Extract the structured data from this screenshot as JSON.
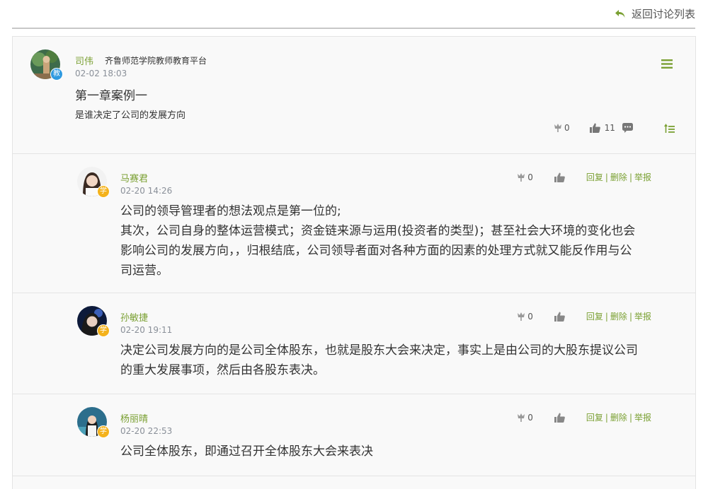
{
  "header": {
    "back_label": "返回讨论列表"
  },
  "topic": {
    "author": "司伟",
    "org": "齐鲁师范学院教师教育平台",
    "date": "02-02 18:03",
    "badge": "教",
    "title": "第一章案例一",
    "description": "是谁决定了公司的发展方向",
    "flower_count": "0",
    "like_count": "11"
  },
  "replies": [
    {
      "author": "马赛君",
      "date": "02-20 14:26",
      "badge": "学",
      "flower_count": "0",
      "reply_label": "回复",
      "delete_label": "删除",
      "report_label": "举报",
      "sep": "|",
      "lines": [
        "公司的领导管理者的想法观点是第一位的;",
        "其次，公司自身的整体运营模式；资金链来源与运用(投资者的类型)；甚至社会大环境的变化也会",
        "影响公司的发展方向，，归根结底，公司领导者面对各种方面的因素的处理方式就又能反作用与公",
        "司运营。"
      ]
    },
    {
      "author": "孙敏捷",
      "date": "02-20 19:11",
      "badge": "学",
      "flower_count": "0",
      "reply_label": "回复",
      "delete_label": "删除",
      "report_label": "举报",
      "sep": "|",
      "lines": [
        "决定公司发展方向的是公司全体股东，也就是股东大会来决定，事实上是由公司的大股东提议公司",
        "的重大发展事项，然后由各股东表决。"
      ]
    },
    {
      "author": "杨丽晴",
      "date": "02-20 22:53",
      "badge": "学",
      "flower_count": "0",
      "reply_label": "回复",
      "delete_label": "删除",
      "report_label": "举报",
      "sep": "|",
      "lines": [
        "公司全体股东，即通过召开全体股东大会来表决"
      ]
    }
  ],
  "colors": {
    "accent": "#7aa032",
    "date": "#8a9099",
    "teacher_badge": "#2f9ae0",
    "student_badge": "#f4b21b"
  },
  "icons": [
    "back-arrow-icon",
    "menu-icon",
    "flower-icon",
    "thumbs-up-icon",
    "comment-icon",
    "sort-up-icon"
  ]
}
